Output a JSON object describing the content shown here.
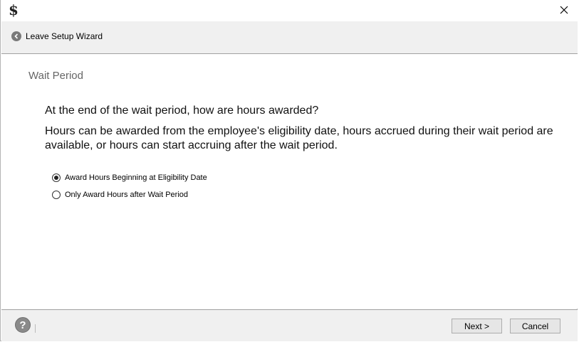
{
  "window": {
    "app_icon_glyph": "$"
  },
  "nav": {
    "back_label": "Leave Setup Wizard"
  },
  "page": {
    "title": "Wait Period",
    "question": "At the end of the wait period, how are hours awarded?",
    "description": "Hours can be awarded from the employee's eligibility date, hours accrued during their wait period are available, or hours can start accruing after the wait period."
  },
  "options": [
    {
      "label": "Award Hours Beginning at Eligibility Date",
      "selected": true
    },
    {
      "label": "Only Award Hours after Wait Period",
      "selected": false
    }
  ],
  "footer": {
    "help_glyph": "?",
    "next_label": "Next >",
    "cancel_label": "Cancel"
  },
  "icons": {
    "app": "dollar-icon",
    "close": "close-icon",
    "back": "back-arrow-icon",
    "help": "help-icon"
  }
}
